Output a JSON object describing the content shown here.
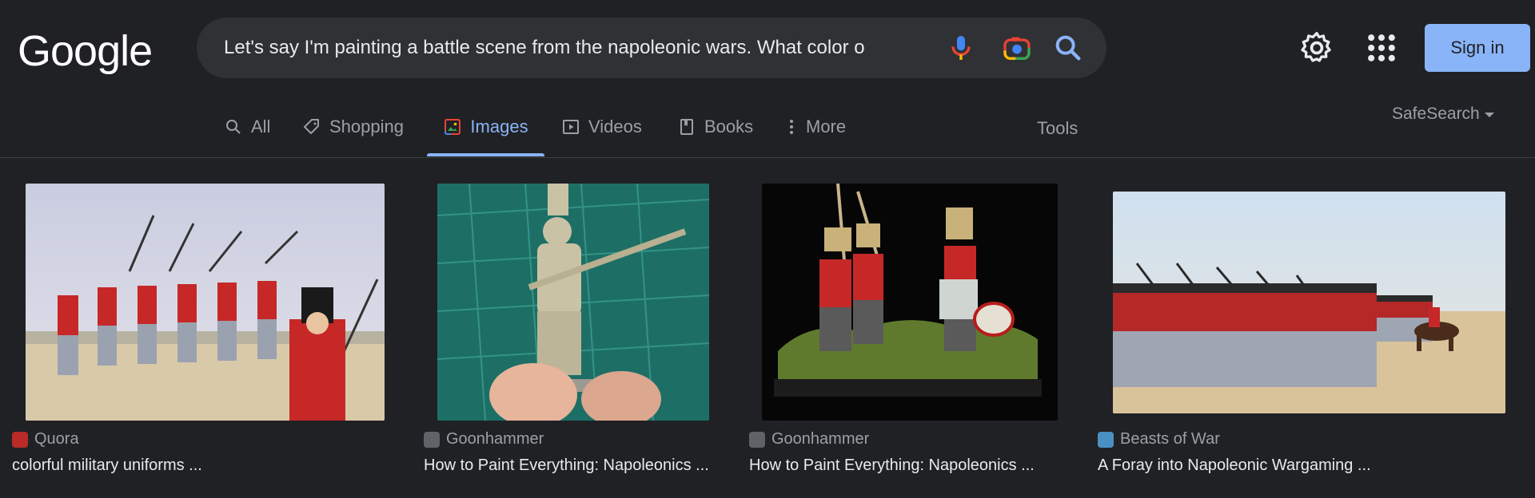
{
  "logo": {
    "text": "Google"
  },
  "search": {
    "query": "Let's say I'm painting a battle scene from the napoleonic wars. What color o"
  },
  "header": {
    "signin_label": "Sign in"
  },
  "tabs": [
    {
      "label": "All",
      "icon": "search-icon"
    },
    {
      "label": "Shopping",
      "icon": "tag-icon"
    },
    {
      "label": "Images",
      "icon": "image-icon",
      "active": true
    },
    {
      "label": "Videos",
      "icon": "play-icon"
    },
    {
      "label": "Books",
      "icon": "book-icon"
    },
    {
      "label": "More",
      "icon": "more-vertical-icon"
    }
  ],
  "tools_label": "Tools",
  "safesearch_label": "SafeSearch",
  "results": [
    {
      "source": "Quora",
      "title": "colorful military uniforms ...",
      "favicon_color": "#b92b27"
    },
    {
      "source": "Goonhammer",
      "title": "How to Paint Everything: Napoleonics ...",
      "favicon_color": "#5f6368"
    },
    {
      "source": "Goonhammer",
      "title": "How to Paint Everything: Napoleonics ...",
      "favicon_color": "#5f6368"
    },
    {
      "source": "Beasts of War",
      "title": "A Foray into Napoleonic Wargaming ...",
      "favicon_color": "#4a90c2"
    }
  ],
  "colors": {
    "background": "#202124",
    "searchbox": "#303134",
    "accent": "#8ab4f8",
    "muted": "#9aa0a6"
  }
}
